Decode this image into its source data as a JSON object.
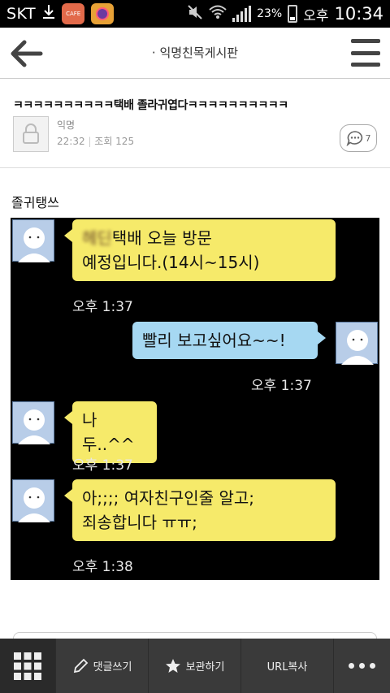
{
  "status": {
    "carrier": "SKT",
    "battery_percent": "23%",
    "time_period": "오후",
    "time": "10:34",
    "app_icons": [
      "download-icon",
      "cafe-app-icon",
      "app-icon"
    ]
  },
  "header": {
    "title": "· 익명친목게시판",
    "icons": [
      "back-arrow-icon",
      "hamburger-menu-icon"
    ]
  },
  "post": {
    "title": "ㅋㅋㅋㅋㅋㅋㅋㅋㅋㅋ택배 졸라귀엽다ㅋㅋㅋㅋㅋㅋㅋㅋㅋㅋ",
    "author": "익명",
    "time": "22:32",
    "views_label": "조회 125",
    "comment_count": "7",
    "body_text": "졸귀탱쓰"
  },
  "chat": {
    "messages": [
      {
        "side": "left",
        "blurred": "헤딘",
        "text_line1": "택배 오늘 방문",
        "text_line2": "예정입니다.(14시~15시)",
        "time": "오후 1:37"
      },
      {
        "side": "right",
        "text_line1": "빨리 보고싶어요~~!",
        "time": "오후 1:37"
      },
      {
        "side": "left",
        "text_line1": "나두..^^",
        "time": "오후 1:37"
      },
      {
        "side": "left",
        "text_line1": "아;;;; 여자친구인줄 알고;",
        "text_line2": "죄송합니다 ㅠㅠ;",
        "time": "오후 1:38"
      }
    ]
  },
  "bottombar": {
    "items": [
      {
        "label": "댓글쓰기",
        "icon": "pencil-icon"
      },
      {
        "label": "보관하기",
        "icon": "star-icon"
      },
      {
        "label": "URL복사",
        "icon": ""
      }
    ],
    "icons": [
      "grid-menu-icon",
      "more-dots-icon"
    ]
  },
  "colors": {
    "chat_bg": "#000000",
    "bubble_yellow": "#f6ea6a",
    "bubble_blue": "#a6d8f2",
    "bottombar_bg": "#3a3a3a"
  }
}
